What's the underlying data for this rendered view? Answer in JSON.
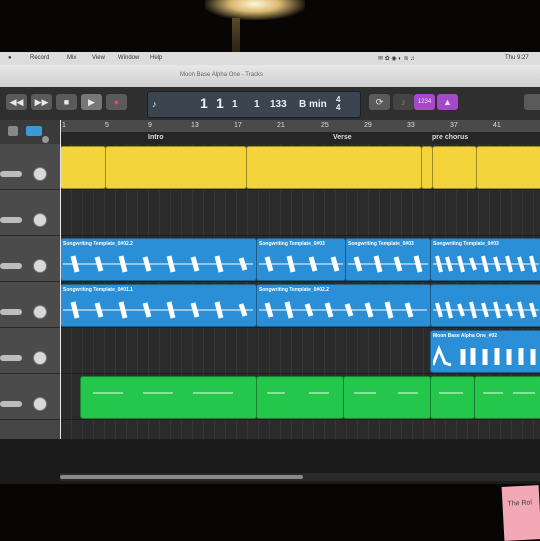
{
  "menubar": {
    "items": [
      "Record",
      "Mix",
      "View",
      "Window",
      "Help"
    ],
    "clock": "Thu 9:27"
  },
  "window": {
    "title": "Moon Base Alpha One - Tracks"
  },
  "transport": {
    "rewind": "◀◀",
    "forward": "▶▶",
    "stop": "■",
    "play": "▶",
    "record": "●",
    "bar": "1",
    "beat": "1",
    "division": "1",
    "tick": "1",
    "tempo": "133",
    "key": "B min",
    "sig_top": "4",
    "sig_bottom": "4",
    "cycle": "⟳",
    "tuner": "♪",
    "count_in": "1234",
    "metronome": "▲"
  },
  "ruler": {
    "marks": [
      "1",
      "5",
      "9",
      "13",
      "17",
      "21",
      "25",
      "29",
      "33",
      "37",
      "41"
    ]
  },
  "arrangement": {
    "markers": [
      "Intro",
      "Verse",
      "pre chorus"
    ]
  },
  "tracks": [
    {
      "color": "yellow",
      "regions": [
        "",
        "",
        "",
        "",
        "",
        ""
      ]
    },
    {
      "color": "empty",
      "regions": []
    },
    {
      "color": "blue",
      "regions": [
        "Songwriting Template_0#02.2",
        "Songwriting Template_0#03",
        "Songwriting Template_0#03",
        "Songwriting Template_0#03"
      ]
    },
    {
      "color": "blue",
      "regions": [
        "Songwriting Template_0#01.1",
        "Songwriting Template_0#02.2",
        "",
        ""
      ]
    },
    {
      "color": "blue",
      "regions": [
        "Moon Base Alpha One_#02"
      ]
    },
    {
      "color": "green",
      "regions": [
        "",
        "",
        "",
        "",
        ""
      ]
    }
  ],
  "sticky_note": "The Rol"
}
